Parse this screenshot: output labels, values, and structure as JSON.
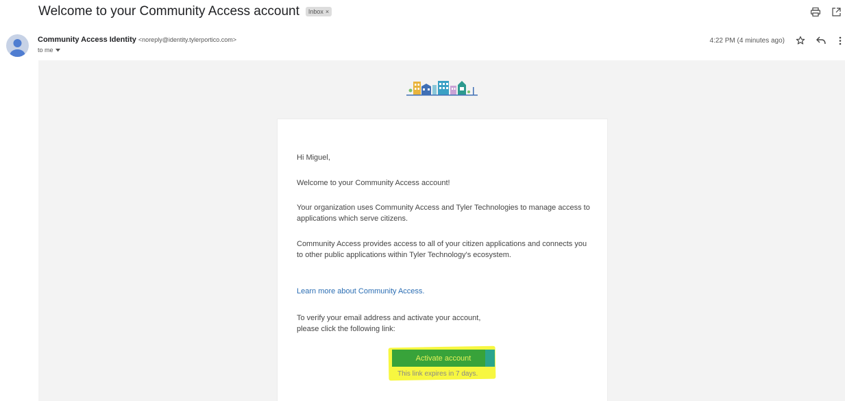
{
  "email": {
    "subject": "Welcome to your Community Access account",
    "label": "Inbox",
    "label_close": "×",
    "sender_name": "Community Access Identity",
    "sender_email": "<noreply@identity.tylerportico.com>",
    "recipient": "to me",
    "timestamp": "4:22 PM (4 minutes ago)"
  },
  "icons": {
    "print": "printer-icon",
    "popout": "open-in-new-window-icon",
    "star": "star-icon",
    "reply": "reply-icon",
    "more": "more-vert-icon",
    "dropdown": "chevron-down-icon",
    "avatar": "default-avatar-icon",
    "logo": "city-buildings-logo"
  },
  "body": {
    "greeting": "Hi Miguel,",
    "welcome": "Welcome to your Community Access account!",
    "paragraph1": "Your organization uses Community Access and Tyler Technologies to manage access to applications which serve citizens.",
    "paragraph2": "Community Access provides access to all of your citizen applications and connects you to other public applications within Tyler Technology's ecosystem.",
    "learn_more": "Learn more about Community Access.",
    "verify_line1": "To verify your email address and activate your account,",
    "verify_line2": "please click the following link:",
    "activate_label": "Activate account",
    "expires_note": "This link expires in 7 days."
  },
  "colors": {
    "activate_button": "#38a33a",
    "highlight": "#f7f740",
    "link": "#2a6db3",
    "email_background": "#f3f3f3"
  }
}
